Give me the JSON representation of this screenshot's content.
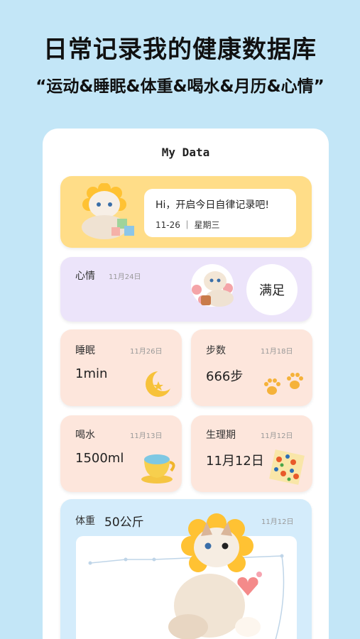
{
  "promo": {
    "title": "日常记录我的健康数据库",
    "subtitle": "“运动&睡眠&体重&喝水&月历&心情”"
  },
  "app": {
    "title": "My Data",
    "greeting": {
      "text": "Hi，开启今日自律记录吧!",
      "date": "11-26 ｜ 星期三"
    },
    "mood": {
      "label": "心情",
      "date": "11月24日",
      "value": "满足"
    },
    "sleep": {
      "label": "睡眠",
      "date": "11月26日",
      "value": "1min"
    },
    "steps": {
      "label": "步数",
      "date": "11月18日",
      "value": "666步"
    },
    "water": {
      "label": "喝水",
      "date": "11月13日",
      "value": "1500ml"
    },
    "period": {
      "label": "生理期",
      "date": "11月12日",
      "value": "11月12日"
    },
    "weight": {
      "label": "体重",
      "value": "50公斤",
      "date": "11月12日"
    }
  },
  "colors": {
    "background": "#c3e6f7",
    "greeting_card": "#ffdd88",
    "mood_card": "#ece4fa",
    "peach_card": "#fde6dc",
    "weight_card": "#d4ecfb"
  }
}
